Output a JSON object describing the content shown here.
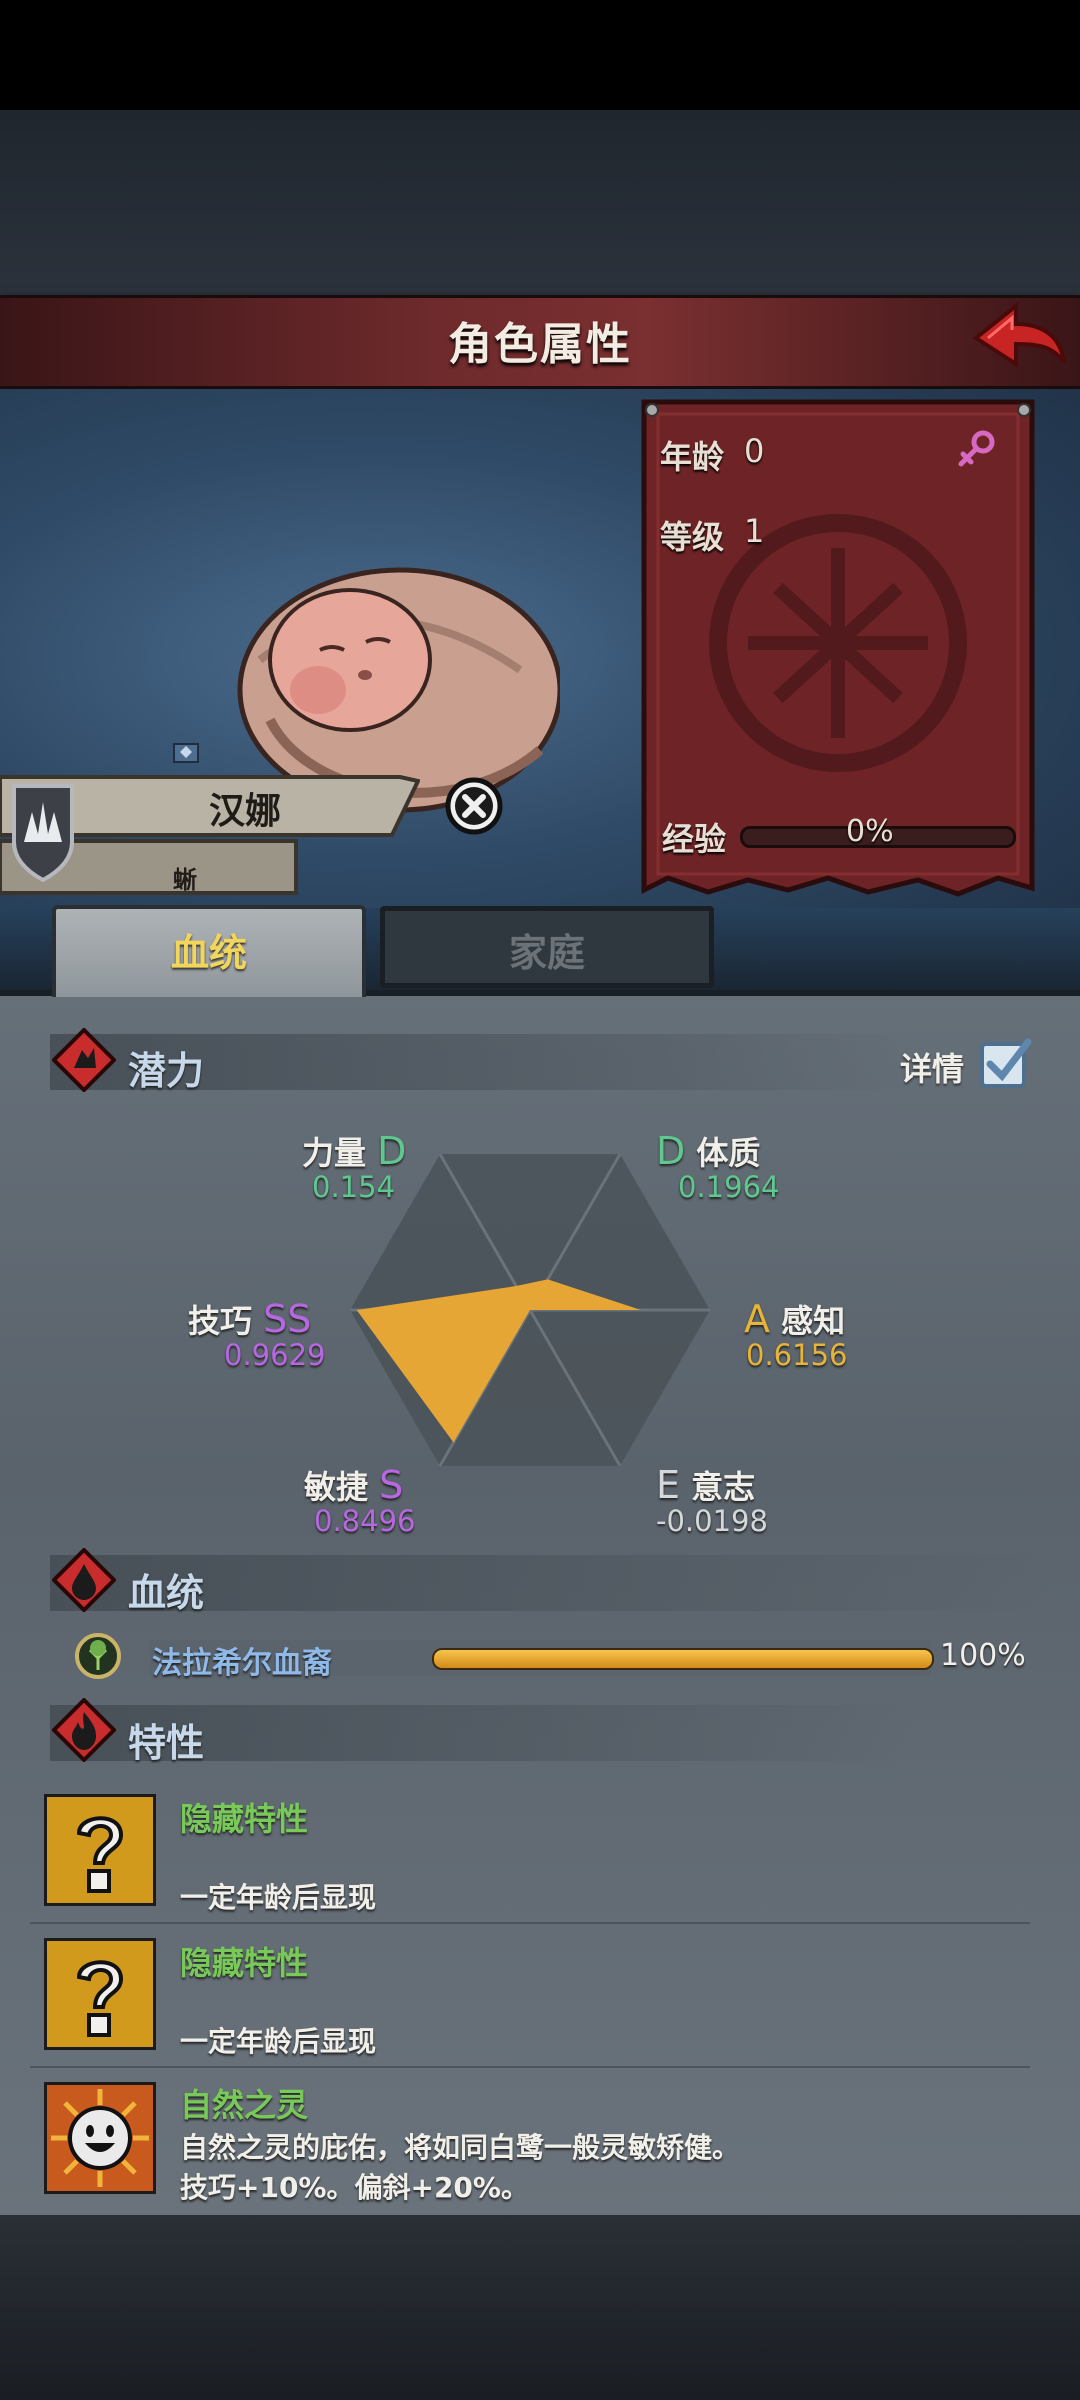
{
  "header": {
    "title": "角色属性"
  },
  "character": {
    "name": "汉娜",
    "subtitle": "蜥"
  },
  "stats": {
    "age_label": "年龄",
    "age_value": "0",
    "level_label": "等级",
    "level_value": "1",
    "exp_label": "经验",
    "exp_value": "0%",
    "exp_fraction": 0
  },
  "tabs": [
    {
      "label": "血统",
      "active": true
    },
    {
      "label": "家庭",
      "active": false
    }
  ],
  "potential": {
    "title": "潜力",
    "details_label": "详情",
    "details_checked": true,
    "attributes": [
      {
        "name": "力量",
        "grade": "D",
        "value": "0.154",
        "color": "#5fc88f"
      },
      {
        "name": "体质",
        "grade": "D",
        "value": "0.1964",
        "color": "#5fc88f"
      },
      {
        "name": "感知",
        "grade": "A",
        "value": "0.6156",
        "color": "#e7b43a"
      },
      {
        "name": "意志",
        "grade": "E",
        "value": "-0.0198",
        "color": "#d5d8da"
      },
      {
        "name": "敏捷",
        "grade": "S",
        "value": "0.8496",
        "color": "#b768e0"
      },
      {
        "name": "技巧",
        "grade": "SS",
        "value": "0.9629",
        "color": "#b768e0"
      }
    ]
  },
  "bloodline": {
    "title": "血统",
    "lineage_name": "法拉希尔血裔",
    "lineage_percent": "100%",
    "lineage_fraction": 1.0
  },
  "traits": {
    "title": "特性",
    "items": [
      {
        "name": "隐藏特性",
        "desc": "一定年龄后显现",
        "icon": "question-icon"
      },
      {
        "name": "隐藏特性",
        "desc": "一定年龄后显现",
        "icon": "question-icon"
      },
      {
        "name": "自然之灵",
        "desc": "自然之灵的庇佑，将如同白鹭一般灵敏矫健。",
        "desc2": "技巧+10%。偏斜+20%。",
        "icon": "smile-sun-icon"
      }
    ]
  }
}
